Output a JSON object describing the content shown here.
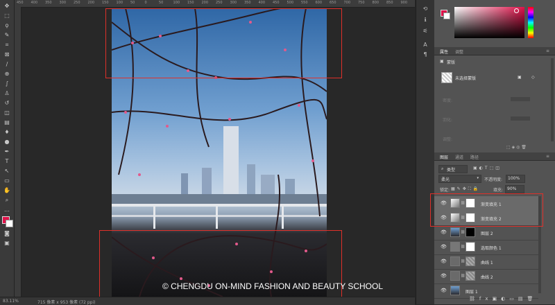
{
  "rulers": {
    "top_ticks": [
      "450",
      "400",
      "350",
      "300",
      "250",
      "200",
      "150",
      "100",
      "50",
      "0",
      "50",
      "100",
      "150",
      "200",
      "250",
      "300",
      "350",
      "400",
      "450",
      "500",
      "550",
      "600",
      "650",
      "700",
      "750",
      "800",
      "850",
      "900"
    ]
  },
  "toolbar": {
    "icons": [
      "move-icon",
      "marquee-icon",
      "lasso-icon",
      "quick-select-icon",
      "crop-icon",
      "frame-icon",
      "eyedropper-icon",
      "healing-icon",
      "brush-icon",
      "stamp-icon",
      "history-brush-icon",
      "eraser-icon",
      "gradient-icon",
      "blur-icon",
      "dodge-icon",
      "pen-icon",
      "type-icon",
      "path-select-icon",
      "shape-icon",
      "hand-icon",
      "zoom-icon",
      "more-icon"
    ],
    "foreground_color": "#e0124a",
    "background_color": "#ffffff"
  },
  "canvas": {
    "watermark": "© CHENGDU ON-MIND FASHION AND BEAUTY SCHOOL",
    "selection_color": "#e0302a"
  },
  "status": {
    "zoom": "83.11%",
    "doc_info": "715 像素 x 953 像素 (72 ppi)"
  },
  "color_panel": {
    "foreground_color": "#e0124a",
    "background_color": "#ffffff"
  },
  "properties": {
    "tab_properties": "属性",
    "tab_adjustments": "调整",
    "section_label": "蒙版",
    "mask_label": "未选择蒙版",
    "density_label": "密度:",
    "feather_label": "羽化:",
    "refine_label": "调整:"
  },
  "layers": {
    "tab_layers": "图层",
    "tab_channels": "通道",
    "tab_paths": "路径",
    "kind_select": "类型",
    "blend_mode": "柔光",
    "opacity_label": "不透明度:",
    "opacity_value": "100%",
    "lock_label": "锁定:",
    "fill_label": "填充:",
    "fill_value": "90%",
    "items": [
      {
        "name": "渐变填充 1",
        "selected": true
      },
      {
        "name": "渐变填充 2",
        "selected": true
      },
      {
        "name": "图层 2",
        "selected": false
      },
      {
        "name": "选取颜色 1",
        "selected": false
      },
      {
        "name": "曲线 1",
        "selected": false
      },
      {
        "name": "曲线 2",
        "selected": false
      },
      {
        "name": "图层 1",
        "selected": false
      }
    ]
  }
}
